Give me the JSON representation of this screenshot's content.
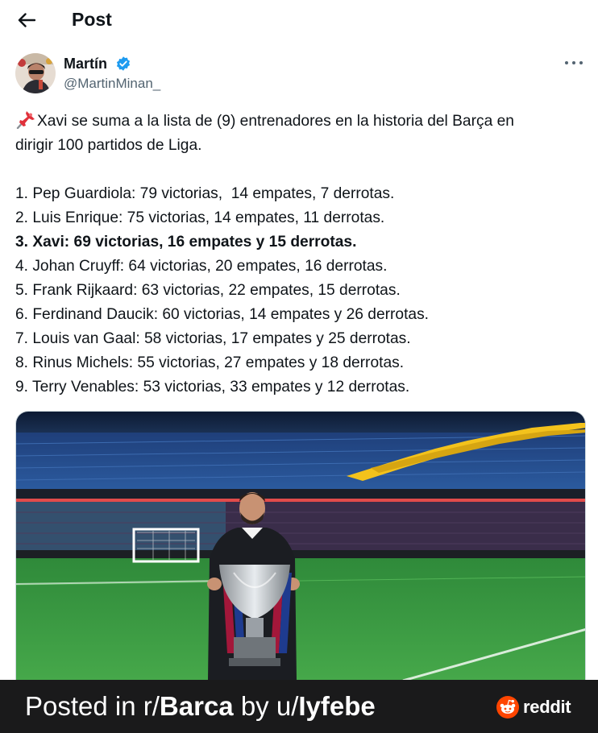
{
  "header": {
    "title": "Post",
    "back_icon": "arrow-left-icon"
  },
  "author": {
    "name": "Martín",
    "handle": "@MartinMinan_",
    "verified": true,
    "verified_color": "#1d9bf0"
  },
  "post": {
    "intro_line_1": "Xavi se suma a la lista de (9) entrenadores en la historia del Barça en",
    "intro_line_2": "dirigir 100 partidos de Liga.",
    "list": [
      "1. Pep Guardiola: 79 victorias,  14 empates, 7 derrotas.",
      "2. Luis Enrique: 75 victorias, 14 empates, 11 derrotas.",
      "3. Xavi: 69 victorias, 16 empates y 15 derrotas.",
      "4. Johan Cruyff: 64 victorias, 20 empates, 16 derrotas.",
      "5. Frank Rijkaard: 63 victorias, 22 empates, 15 derrotas.",
      "6. Ferdinand Daucik: 60 victorias, 14 empates y 26 derrotas.",
      "7. Louis van Gaal: 58 victorias, 17 empates y 25 derrotas.",
      "8. Rinus Michels: 55 victorias, 27 empates y 18 derrotas.",
      "9. Terry Venables: 53 victorias, 33 empates y 12 derrotas."
    ],
    "highlighted_index": 2
  },
  "footer": {
    "prefix": "Posted in r/",
    "subreddit": "Barca",
    "middle": " by u/",
    "username": "Iyfebe",
    "brand": "reddit"
  },
  "colors": {
    "footer_bg": "#1a1a1b",
    "reddit_orange": "#ff4500",
    "handle_gray": "#536471"
  }
}
